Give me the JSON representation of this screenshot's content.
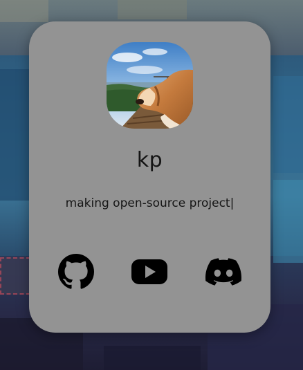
{
  "profile": {
    "name": "kp",
    "tagline": "making open-source project|",
    "avatar_icon": "dog-photo-avatar"
  },
  "socials": [
    {
      "name": "github",
      "icon": "github-icon"
    },
    {
      "name": "youtube",
      "icon": "youtube-icon"
    },
    {
      "name": "discord",
      "icon": "discord-icon"
    }
  ],
  "colors": {
    "card_background": "#939393",
    "text": "#141414",
    "icon": "#000000"
  }
}
